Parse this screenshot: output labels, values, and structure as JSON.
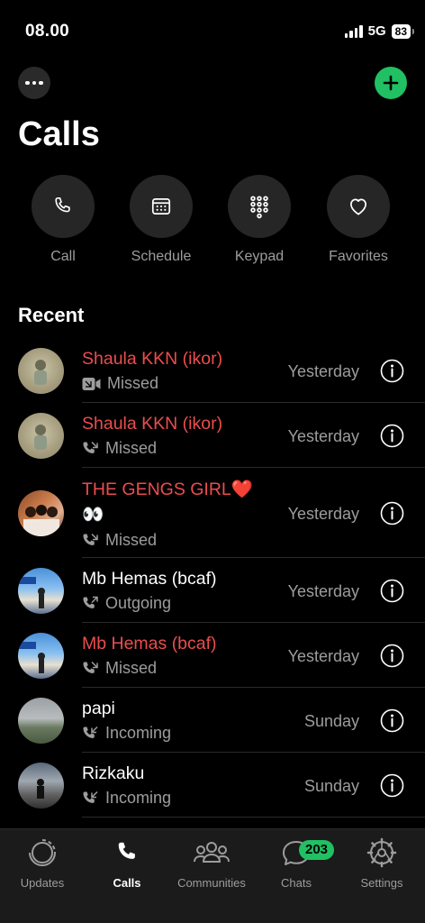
{
  "status_bar": {
    "time": "08.00",
    "network": "5G",
    "battery": "83"
  },
  "page": {
    "title": "Calls"
  },
  "actions": [
    {
      "label": "Call",
      "icon": "phone-icon"
    },
    {
      "label": "Schedule",
      "icon": "calendar-icon"
    },
    {
      "label": "Keypad",
      "icon": "keypad-icon"
    },
    {
      "label": "Favorites",
      "icon": "heart-icon"
    }
  ],
  "section_title": "Recent",
  "calls": [
    {
      "name": "Shaula KKN (ikor)",
      "status": "Missed",
      "type": "video",
      "direction": "missed",
      "when": "Yesterday",
      "missed": true
    },
    {
      "name": "Shaula KKN (ikor)",
      "status": "Missed",
      "type": "voice",
      "direction": "missed",
      "when": "Yesterday",
      "missed": true
    },
    {
      "name": "THE GENGS GIRL❤️",
      "name_line2": "👀",
      "status": "Missed",
      "type": "voice",
      "direction": "missed",
      "when": "Yesterday",
      "missed": true
    },
    {
      "name": "Mb Hemas (bcaf)",
      "status": "Outgoing",
      "type": "voice",
      "direction": "outgoing",
      "when": "Yesterday",
      "missed": false
    },
    {
      "name": "Mb Hemas (bcaf)",
      "status": "Missed",
      "type": "voice",
      "direction": "missed",
      "when": "Yesterday",
      "missed": true
    },
    {
      "name": "papi",
      "status": "Incoming",
      "type": "voice",
      "direction": "incoming",
      "when": "Sunday",
      "missed": false
    },
    {
      "name": "Rizkaku",
      "status": "Incoming",
      "type": "voice",
      "direction": "incoming",
      "when": "Sunday",
      "missed": false
    }
  ],
  "tabs": [
    {
      "label": "Updates",
      "icon": "updates-icon",
      "active": false
    },
    {
      "label": "Calls",
      "icon": "phone-icon",
      "active": true
    },
    {
      "label": "Communities",
      "icon": "communities-icon",
      "active": false
    },
    {
      "label": "Chats",
      "icon": "chats-icon",
      "active": false,
      "badge": "203"
    },
    {
      "label": "Settings",
      "icon": "settings-icon",
      "active": false
    }
  ],
  "colors": {
    "accent": "#21c063",
    "missed": "#eb4d4d",
    "muted": "#9d9d9d"
  }
}
